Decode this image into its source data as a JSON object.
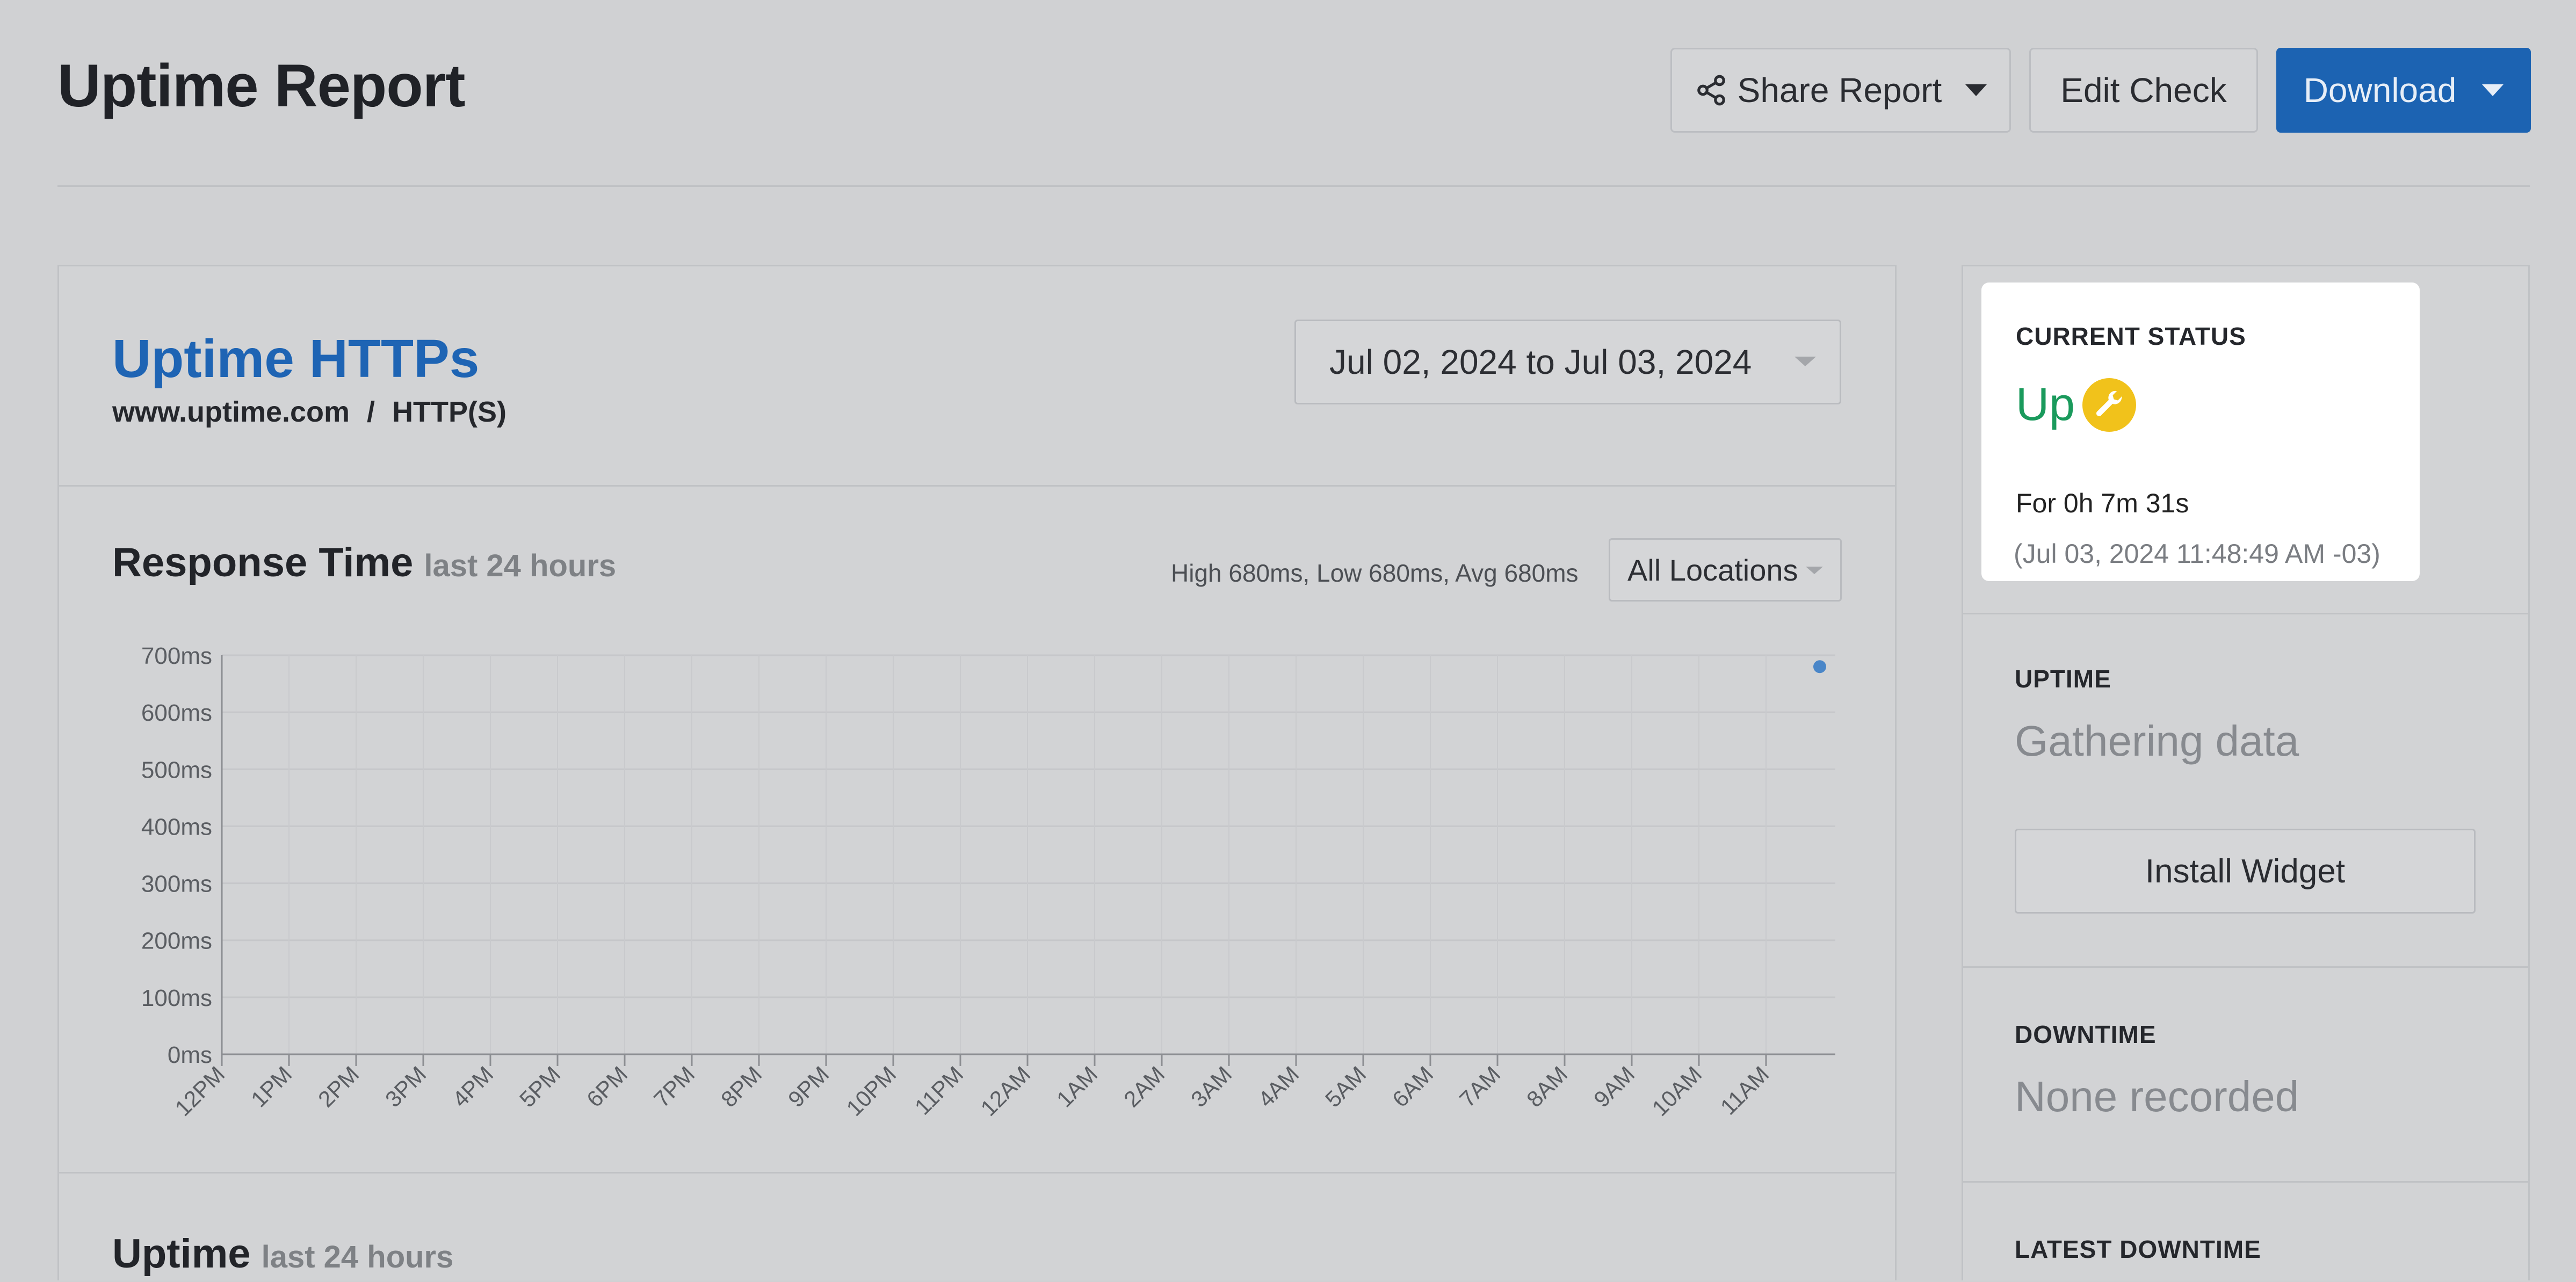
{
  "page": {
    "title": "Uptime Report"
  },
  "toolbar": {
    "share_label": "Share Report",
    "edit_label": "Edit Check",
    "download_label": "Download",
    "download_color": "#1c63b2"
  },
  "check": {
    "name": "Uptime HTTPs",
    "url": "www.uptime.com",
    "separator": "/",
    "type": "HTTP(S)",
    "date_range": "Jul 02, 2024 to Jul 03, 2024"
  },
  "response_time": {
    "title": "Response Time",
    "subtitle": "last 24 hours",
    "stats": "High 680ms, Low 680ms, Avg 680ms",
    "location_select": "All Locations"
  },
  "uptime_section": {
    "title": "Uptime",
    "subtitle": "last 24 hours"
  },
  "sidebar": {
    "current_status": {
      "label": "CURRENT STATUS",
      "value": "Up",
      "value_color": "#1a9a5c",
      "icon": "wrench-icon",
      "duration": "For 0h 7m 31s",
      "since": "(Jul 03, 2024 11:48:49 AM -03)"
    },
    "uptime": {
      "label": "UPTIME",
      "value": "Gathering data",
      "widget_button": "Install Widget"
    },
    "downtime": {
      "label": "DOWNTIME",
      "value": "None recorded"
    },
    "latest_downtime": {
      "label": "LATEST DOWNTIME"
    }
  },
  "chart_data": {
    "type": "scatter",
    "y_ticks": [
      "700ms",
      "600ms",
      "500ms",
      "400ms",
      "300ms",
      "200ms",
      "100ms",
      "0ms"
    ],
    "ylim": [
      0,
      700
    ],
    "x_ticks": [
      "12PM",
      "1PM",
      "2PM",
      "3PM",
      "4PM",
      "5PM",
      "6PM",
      "7PM",
      "8PM",
      "9PM",
      "10PM",
      "11PM",
      "12AM",
      "1AM",
      "2AM",
      "3AM",
      "4AM",
      "5AM",
      "6AM",
      "7AM",
      "8AM",
      "9AM",
      "10AM",
      "11AM"
    ],
    "series": [
      {
        "values": [
          {
            "x": 23.8,
            "y": 680
          }
        ],
        "color": "#4a86c8"
      }
    ],
    "grid": true
  }
}
